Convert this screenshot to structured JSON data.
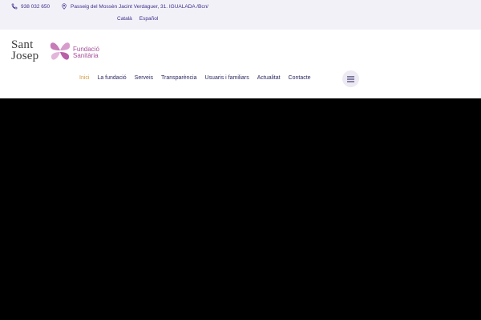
{
  "topbar": {
    "phone": "938 032 650",
    "address": "Passeig del Mossèn Jacint Verdaguer, 31. IGUALADA /Bcn/",
    "languages": [
      "Català",
      "Español"
    ]
  },
  "logo": {
    "line1": "Sant",
    "line2": "Josep",
    "tagline1": "Fundació",
    "tagline2": "Sanitària"
  },
  "nav": {
    "items": [
      {
        "label": "Inici",
        "active": true
      },
      {
        "label": "La fundació",
        "active": false
      },
      {
        "label": "Serveis",
        "active": false
      },
      {
        "label": "Transparència",
        "active": false
      },
      {
        "label": "Usuaris i familiars",
        "active": false
      },
      {
        "label": "Actualitat",
        "active": false
      },
      {
        "label": "Contacte",
        "active": false
      }
    ]
  },
  "icons": {
    "phone": "phone-icon",
    "location": "location-pin-icon",
    "menu": "hamburger-menu-icon"
  },
  "colors": {
    "topbar_bg": "#f3f1f8",
    "brand_purple": "#3b2f8a",
    "nav_text": "#2b2860",
    "nav_active": "#d29c3f",
    "logo_pink": "#a8509b",
    "hero_bg": "#000000"
  }
}
